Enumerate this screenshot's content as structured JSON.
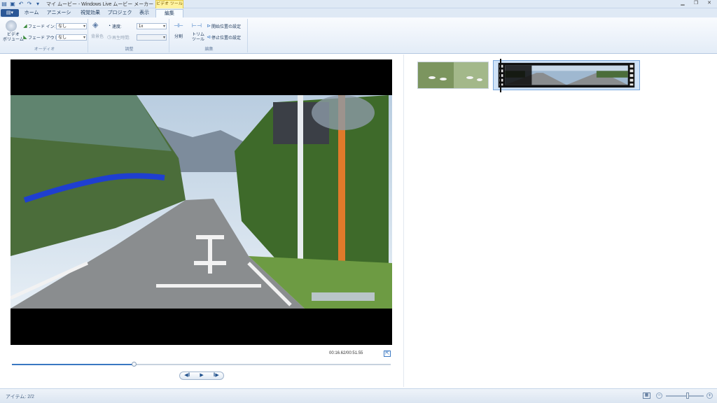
{
  "window": {
    "title": "マイ ムービー - Windows Live ムービー メーカー",
    "context_tab": "ビデオ ツール",
    "controls": [
      "minimize",
      "restore",
      "close"
    ]
  },
  "quick_access": [
    "app-icon",
    "save-icon",
    "undo-icon",
    "redo-icon",
    "customize-icon"
  ],
  "app_menu_icon": "app-menu-icon",
  "tabs": [
    {
      "label": "ホーム",
      "active": false
    },
    {
      "label": "アニメーション",
      "active": false
    },
    {
      "label": "視覚効果",
      "active": false
    },
    {
      "label": "プロジェクト",
      "active": false
    },
    {
      "label": "表示",
      "active": false
    },
    {
      "label": "編集",
      "active": true
    }
  ],
  "ribbon": {
    "audio": {
      "label": "オーディオ",
      "video_volume": "ビデオ\nボリューム",
      "fade_in_label": "フェード イン:",
      "fade_in_value": "なし",
      "fade_out_label": "フェード アウト:",
      "fade_out_value": "なし"
    },
    "adjust": {
      "label": "調整",
      "bg_color": "背景色",
      "speed_label": "速度:",
      "speed_value": "1x",
      "duration_label": "再生時間:",
      "duration_value": ""
    },
    "edit": {
      "label": "編集",
      "split": "分割",
      "trim_tool": "トリム\nツール",
      "set_start": "開始位置の設定",
      "set_end": "停止位置の設定"
    }
  },
  "preview": {
    "time": "00:16.62/00:51.55",
    "progress": 0.322,
    "transport": [
      "previous-frame-icon",
      "play-icon",
      "next-frame-icon"
    ]
  },
  "storyboard": {
    "clips": [
      "clip-1",
      "clip-2"
    ],
    "selected_clip": 1
  },
  "status": {
    "items": "アイテム: 2/2",
    "zoom_level": 0.58
  },
  "colors": {
    "accent": "#3a78c2",
    "ribbon_bg": "#e3ecf7",
    "selection": "#cfe2f7"
  }
}
